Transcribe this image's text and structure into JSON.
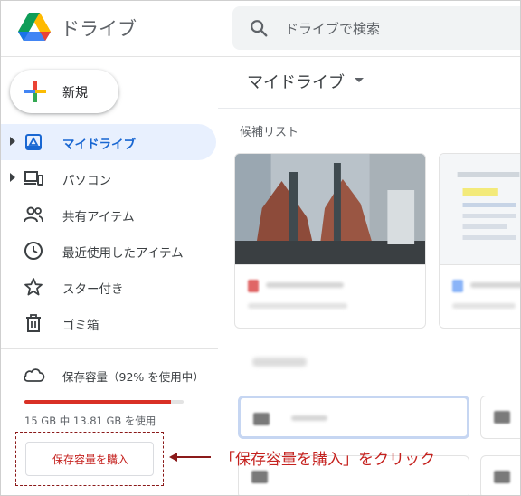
{
  "header": {
    "app_title": "ドライブ",
    "search_placeholder": "ドライブで検索"
  },
  "sidebar": {
    "new_label": "新規",
    "items": [
      {
        "label": "マイドライブ",
        "icon": "my-drive-icon",
        "active": true,
        "expandable": true
      },
      {
        "label": "パソコン",
        "icon": "computers-icon",
        "active": false,
        "expandable": true
      },
      {
        "label": "共有アイテム",
        "icon": "shared-icon",
        "active": false,
        "expandable": false
      },
      {
        "label": "最近使用したアイテム",
        "icon": "clock-icon",
        "active": false,
        "expandable": false
      },
      {
        "label": "スター付き",
        "icon": "star-icon",
        "active": false,
        "expandable": false
      },
      {
        "label": "ゴミ箱",
        "icon": "trash-icon",
        "active": false,
        "expandable": false
      }
    ],
    "storage": {
      "label": "保存容量（92% を使用中）",
      "usage": "15 GB 中 13.81 GB を使用",
      "percent": 92,
      "buy_label": "保存容量を購入"
    }
  },
  "main": {
    "title": "マイドライブ",
    "suggested_label": "候補リスト"
  },
  "annotation": {
    "text": "「保存容量を購入」をクリック"
  },
  "colors": {
    "accent": "#1967d2",
    "active_bg": "#e8f0fe",
    "storage_bar": "#d93025",
    "annotation": "#c5221f",
    "annotation_border": "#8b1a1a"
  }
}
